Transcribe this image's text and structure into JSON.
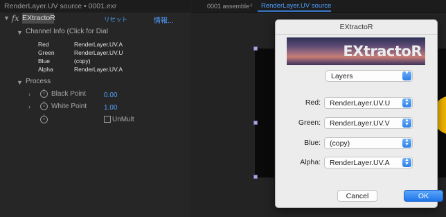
{
  "effect_controls": {
    "header_title": "RenderLayer.UV source • 0001.exr",
    "fx_label": "fx",
    "effect_name": "EXtractoR",
    "reset_label": "リセット",
    "about_label": "情報...",
    "channel_info_label": "Channel Info (Click for Dial",
    "channels": [
      {
        "label": "Red",
        "value": "RenderLayer.UV.A"
      },
      {
        "label": "Green",
        "value": "RenderLayer.UV.U"
      },
      {
        "label": "Blue",
        "value": "(copy)"
      },
      {
        "label": "Alpha",
        "value": "RenderLayer.UV.A"
      }
    ],
    "process_label": "Process",
    "black_point": {
      "label": "Black Point",
      "value": "0.00"
    },
    "white_point": {
      "label": "White Point",
      "value": "1.00"
    },
    "unmult_label": "UnMult"
  },
  "viewer": {
    "tab_1": "0001 assemble",
    "tab_arrow": "‹",
    "tab_2": "RenderLayer.UV source"
  },
  "dialog": {
    "title": "EXtractoR",
    "banner_text": "EXtractoR",
    "layers_popup": "Layers",
    "fields": [
      {
        "label": "Red:",
        "value": "RenderLayer.UV.U"
      },
      {
        "label": "Green:",
        "value": "RenderLayer.UV.V"
      },
      {
        "label": "Blue:",
        "value": "(copy)"
      },
      {
        "label": "Alpha:",
        "value": "RenderLayer.UV.A"
      }
    ],
    "cancel_label": "Cancel",
    "ok_label": "OK"
  },
  "colors": {
    "accent_blue": "#4fa0ff",
    "ok_button": "#1f74ea",
    "yellow_shape": "#f2b400"
  }
}
